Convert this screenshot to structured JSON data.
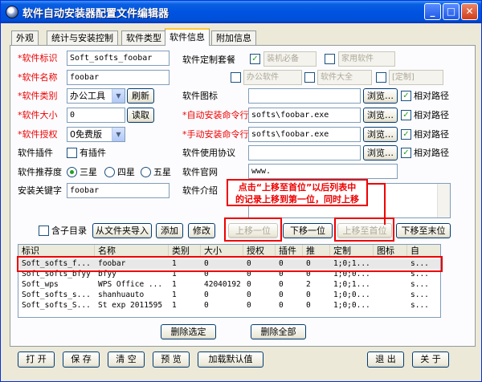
{
  "window": {
    "title": "软件自动安装器配置文件编辑器"
  },
  "tabs": [
    "外观",
    "统计与安装控制",
    "软件类型",
    "软件信息",
    "附加信息"
  ],
  "form": {
    "id_label": "*软件标识",
    "id_value": "Soft_softs_foobar",
    "name_label": "*软件名称",
    "name_value": "foobar",
    "category_label": "*软件类别",
    "category_value": "办公工具",
    "refresh_label": "刷新",
    "size_label": "*软件大小",
    "size_value": "0",
    "read_label": "读取",
    "license_label": "*软件授权",
    "license_value": "0免费版",
    "plugin_label": "软件插件",
    "plugin_check_label": "有插件",
    "rating_label": "软件推荐度",
    "rating_options": [
      "三星",
      "四星",
      "五星"
    ],
    "keyword_label": "安装关键字",
    "keyword_value": "foobar",
    "suite_label": "软件定制套餐",
    "suite_options": [
      "装机必备",
      "家用软件",
      "办公软件",
      "软件大全",
      "[定制]"
    ],
    "icon_label": "软件图标",
    "auto_cmd_label": "*自动安装命令行",
    "auto_cmd_value": "softs\\foobar.exe",
    "manual_cmd_label": "*手动安装命令行",
    "manual_cmd_value": "softs\\foobar.exe",
    "agreement_label": "软件使用协议",
    "website_label": "软件官网",
    "website_value": "www.",
    "intro_label": "软件介绍",
    "browse_label": "浏览…",
    "relative_label": "相对路径"
  },
  "annotation": {
    "text_line1": "点击“上移至首位”以后列表中",
    "text_line2": "的记录上移到第一位，同时上移"
  },
  "actions": {
    "subdir_label": "含子目录",
    "import_label": "从文件夹导入",
    "add_label": "添加",
    "modify_label": "修改",
    "up_label": "上移一位",
    "down_label": "下移一位",
    "top_label": "上移至首位",
    "bottom_label": "下移至末位"
  },
  "table": {
    "columns": [
      "标识",
      "名称",
      "类别",
      "大小",
      "授权",
      "插件",
      "推",
      "定制",
      "图标",
      "自"
    ],
    "rows": [
      [
        "Soft_softs_f...",
        "foobar",
        "1",
        "0",
        "0",
        "0",
        "0",
        "1;0;1...",
        "",
        "s..."
      ],
      [
        "Soft_softs_bfyy",
        "bfyy",
        "1",
        "0",
        "0",
        "0",
        "0",
        "1;0;0...",
        "",
        "s..."
      ],
      [
        "Soft_wps",
        "WPS Office ...",
        "1",
        "42040192",
        "0",
        "0",
        "2",
        "1;0;1...",
        "",
        "s..."
      ],
      [
        "Soft_softs_s...",
        "shanhuauto",
        "1",
        "0",
        "0",
        "0",
        "0",
        "1;0;0...",
        "",
        "s..."
      ],
      [
        "Soft_softs_S...",
        "St exp 2011595",
        "1",
        "0",
        "0",
        "0",
        "0",
        "1;0;0...",
        "",
        "s..."
      ]
    ]
  },
  "list_buttons": {
    "delete_selected": "删除选定",
    "delete_all": "删除全部"
  },
  "bottom_buttons": [
    "打 开",
    "保 存",
    "清 空",
    "预 览",
    "加载默认值",
    "退 出",
    "关 于"
  ]
}
